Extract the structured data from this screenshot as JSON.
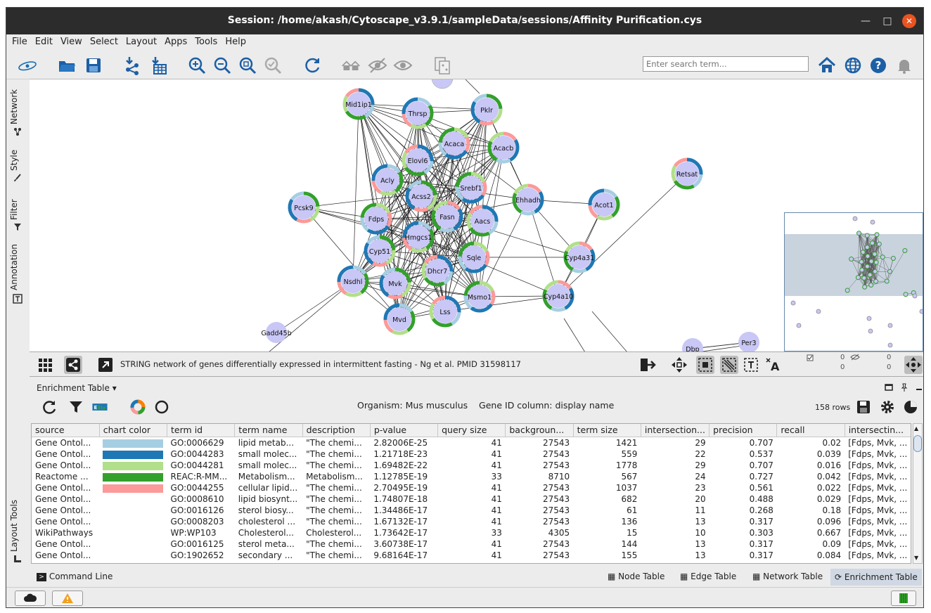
{
  "window": {
    "title": "Session: /home/akash/Cytoscape_v3.9.1/sampleData/sessions/Affinity Purification.cys"
  },
  "menu": [
    "File",
    "Edit",
    "View",
    "Select",
    "Layout",
    "Apps",
    "Tools",
    "Help"
  ],
  "search": {
    "placeholder": "Enter search term..."
  },
  "side_tabs": [
    "Network",
    "Style",
    "Filter",
    "Annotation",
    "Layout Tools"
  ],
  "network": {
    "description": "STRING network of genes differentially expressed in intermittent fasting - Ng et al. PMID 31598117",
    "nodes": [
      "Mid1ip1",
      "Thrsp",
      "Pklr",
      "Acaca",
      "Acacb",
      "Elovl6",
      "Acly",
      "Acss2",
      "Srebf1",
      "Ehhadh",
      "Retsat",
      "Acot1",
      "Pcsk9",
      "Fdps",
      "Fasn",
      "Aacs",
      "Hmgcs1",
      "Cyp51",
      "Sqle",
      "Cyp4a31",
      "Dhcr7",
      "Nsdhl",
      "Mvk",
      "Msmo1",
      "Cyp4a10",
      "Lss",
      "Mvd",
      "Gadd45b",
      "Dbp",
      "Per3"
    ],
    "counters": {
      "selected_nodes": "0",
      "hidden_nodes": "0",
      "selected_edges": "0",
      "hidden_edges": "0"
    }
  },
  "enrichment": {
    "panel_title": "Enrichment Table",
    "organism_label": "Organism: Mus musculus",
    "gene_id_label": "Gene ID column: display name",
    "row_count": "158 rows",
    "columns": [
      "source",
      "chart color",
      "term id",
      "term name",
      "description",
      "p-value",
      "query size",
      "backgroun...",
      "term size",
      "intersection...",
      "precision",
      "recall",
      "intersectin..."
    ],
    "rows": [
      {
        "source": "Gene Ontol...",
        "color": "#a6cee3",
        "term_id": "GO:0006629",
        "term_name": "lipid metab...",
        "description": "\"The chemi...",
        "p_value": "2.82006E-25",
        "query_size": "41",
        "background": "27543",
        "term_size": "1421",
        "intersection": "29",
        "precision": "0.707",
        "recall": "0.02",
        "genes": "[Fdps, Mvk, ..."
      },
      {
        "source": "Gene Ontol...",
        "color": "#1f78b4",
        "term_id": "GO:0044283",
        "term_name": "small molec...",
        "description": "\"The chemi...",
        "p_value": "1.21718E-23",
        "query_size": "41",
        "background": "27543",
        "term_size": "559",
        "intersection": "22",
        "precision": "0.537",
        "recall": "0.039",
        "genes": "[Fdps, Mvk, ..."
      },
      {
        "source": "Gene Ontol...",
        "color": "#b2df8a",
        "term_id": "GO:0044281",
        "term_name": "small molec...",
        "description": "\"The chemi...",
        "p_value": "1.69482E-22",
        "query_size": "41",
        "background": "27543",
        "term_size": "1778",
        "intersection": "29",
        "precision": "0.707",
        "recall": "0.016",
        "genes": "[Fdps, Mvk, ..."
      },
      {
        "source": "Reactome ...",
        "color": "#33a02c",
        "term_id": "REAC:R-MM...",
        "term_name": "Metabolism...",
        "description": "Metabolism...",
        "p_value": "1.12785E-19",
        "query_size": "33",
        "background": "8710",
        "term_size": "567",
        "intersection": "24",
        "precision": "0.727",
        "recall": "0.042",
        "genes": "[Fdps, Mvk, ..."
      },
      {
        "source": "Gene Ontol...",
        "color": "#fb9a99",
        "term_id": "GO:0044255",
        "term_name": "cellular lipid...",
        "description": "\"The chemi...",
        "p_value": "2.70495E-19",
        "query_size": "41",
        "background": "27543",
        "term_size": "1037",
        "intersection": "23",
        "precision": "0.561",
        "recall": "0.022",
        "genes": "[Fdps, Mvk, ..."
      },
      {
        "source": "Gene Ontol...",
        "color": "",
        "term_id": "GO:0008610",
        "term_name": "lipid biosynt...",
        "description": "\"The chemi...",
        "p_value": "1.74807E-18",
        "query_size": "41",
        "background": "27543",
        "term_size": "682",
        "intersection": "20",
        "precision": "0.488",
        "recall": "0.029",
        "genes": "[Fdps, Mvk, ..."
      },
      {
        "source": "Gene Ontol...",
        "color": "",
        "term_id": "GO:0016126",
        "term_name": "sterol biosy...",
        "description": "\"The chemi...",
        "p_value": "1.34486E-17",
        "query_size": "41",
        "background": "27543",
        "term_size": "61",
        "intersection": "11",
        "precision": "0.268",
        "recall": "0.18",
        "genes": "[Fdps, Mvk, ..."
      },
      {
        "source": "Gene Ontol...",
        "color": "",
        "term_id": "GO:0008203",
        "term_name": "cholesterol ...",
        "description": "\"The chemi...",
        "p_value": "1.67132E-17",
        "query_size": "41",
        "background": "27543",
        "term_size": "136",
        "intersection": "13",
        "precision": "0.317",
        "recall": "0.096",
        "genes": "[Fdps, Mvk, ..."
      },
      {
        "source": "WikiPathways",
        "color": "",
        "term_id": "WP:WP103",
        "term_name": "Cholesterol...",
        "description": "Cholesterol...",
        "p_value": "1.73642E-17",
        "query_size": "33",
        "background": "4305",
        "term_size": "15",
        "intersection": "10",
        "precision": "0.303",
        "recall": "0.667",
        "genes": "[Fdps, Mvk, ..."
      },
      {
        "source": "Gene Ontol...",
        "color": "",
        "term_id": "GO:0016125",
        "term_name": "sterol meta...",
        "description": "\"The chemi...",
        "p_value": "3.60738E-17",
        "query_size": "41",
        "background": "27543",
        "term_size": "144",
        "intersection": "13",
        "precision": "0.317",
        "recall": "0.09",
        "genes": "[Fdps, Mvk, ..."
      },
      {
        "source": "Gene Ontol...",
        "color": "",
        "term_id": "GO:1902652",
        "term_name": "secondary ...",
        "description": "\"The chemi...",
        "p_value": "9.68164E-17",
        "query_size": "41",
        "background": "27543",
        "term_size": "155",
        "intersection": "13",
        "precision": "0.317",
        "recall": "0.084",
        "genes": "[Fdps, Mvk, ..."
      }
    ]
  },
  "bottom_tabs": {
    "command_line": "Command Line",
    "node_table": "Node Table",
    "edge_table": "Edge Table",
    "network_table": "Network Table",
    "enrichment_table": "Enrichment Table"
  },
  "colors": {
    "node_fill": "#c9c7f5",
    "ring_dark": "#1f78b4",
    "ring_light": "#a6cee3",
    "ring_green": "#33a02c",
    "ring_lightgreen": "#b2df8a",
    "ring_pink": "#fb9a99",
    "accent_blue": "#1c6fb5"
  }
}
